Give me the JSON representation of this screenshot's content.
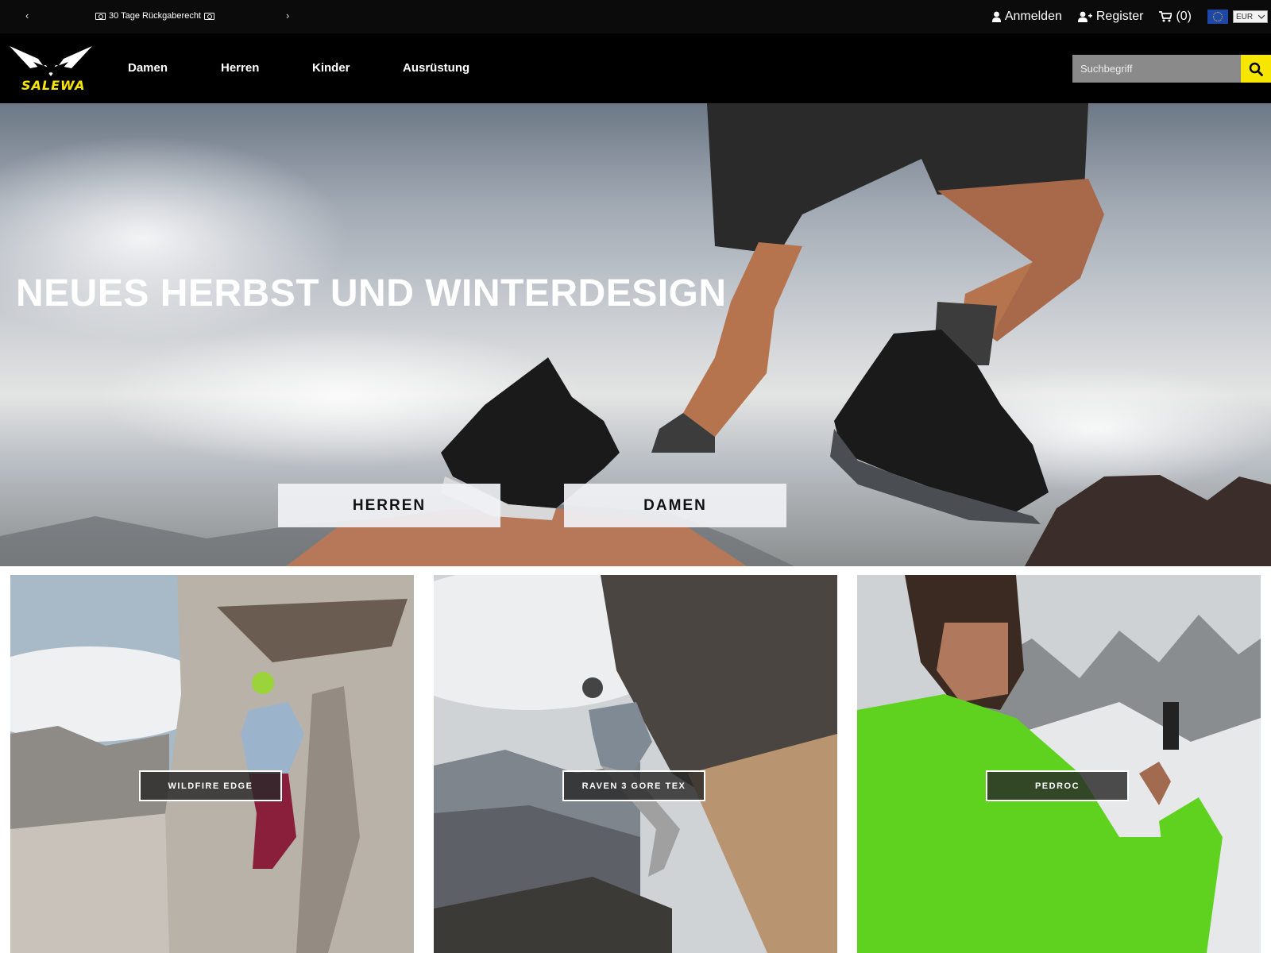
{
  "topbar": {
    "prev_arrow": "‹",
    "next_arrow": "›",
    "promo_text": "30 Tage Rückgaberecht",
    "login": "Anmelden",
    "register": "Register",
    "cart": "(0)",
    "currency": "EUR"
  },
  "brand": {
    "logo_text": "SALEWA"
  },
  "nav": {
    "items": [
      {
        "label": "Damen"
      },
      {
        "label": "Herren"
      },
      {
        "label": "Kinder"
      },
      {
        "label": "Ausrüstung"
      }
    ],
    "search_placeholder": "Suchbegriff"
  },
  "hero": {
    "title": "NEUES HERBST UND WINTERDESIGN",
    "buttons": [
      {
        "label": "HERREN"
      },
      {
        "label": "DAMEN"
      }
    ]
  },
  "tiles": [
    {
      "label": "WILDFIRE EDGE"
    },
    {
      "label": "RAVEN 3 GORE TEX"
    },
    {
      "label": "PEDROC"
    }
  ],
  "colors": {
    "brand_yellow": "#f7e600",
    "header_bg": "#000000",
    "search_bg": "#8a8a8a"
  },
  "icons": {
    "user": "user-icon",
    "register": "user-plus-icon",
    "cart": "cart-icon",
    "search": "search-icon",
    "promo": "money-icon"
  }
}
